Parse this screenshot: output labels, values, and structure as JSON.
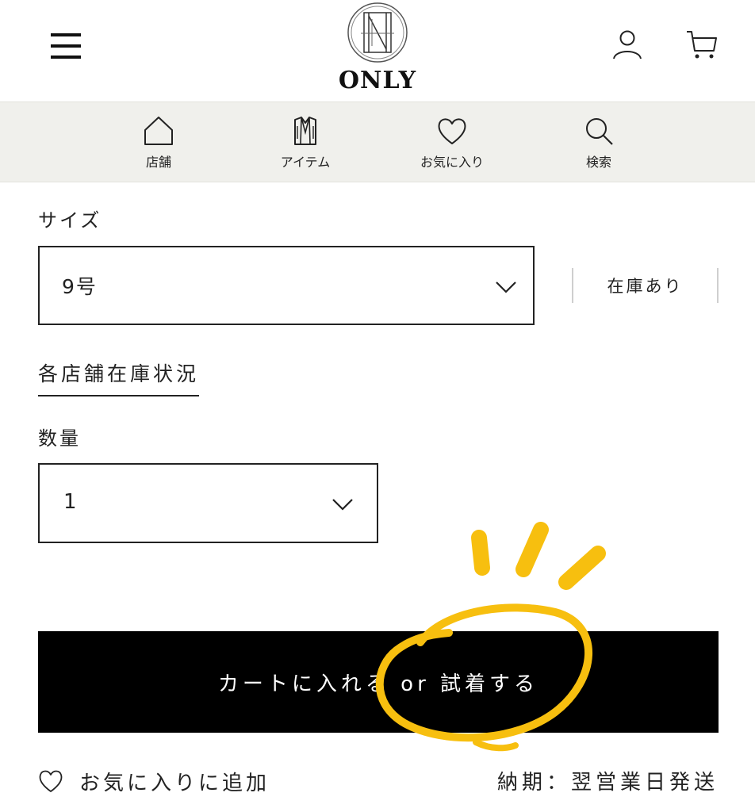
{
  "header": {
    "logo_text": "ONLY",
    "menu_icon": "hamburger-icon",
    "account_icon": "user-icon",
    "cart_icon": "cart-icon"
  },
  "nav": [
    {
      "label": "店舗",
      "icon": "home-icon"
    },
    {
      "label": "アイテム",
      "icon": "jacket-icon"
    },
    {
      "label": "お気に入り",
      "icon": "heart-icon"
    },
    {
      "label": "検索",
      "icon": "search-icon"
    }
  ],
  "size": {
    "label": "サイズ",
    "selected": "9号",
    "stock_status": "在庫あり"
  },
  "store_stock_link": "各店舗在庫状況",
  "quantity": {
    "label": "数量",
    "selected": "1"
  },
  "cart_button": {
    "label": "カートに入れる or 試着する"
  },
  "favorite_add": {
    "label": "お気に入りに追加",
    "icon": "heart-icon"
  },
  "delivery": "納期：翌営業日発送",
  "colors": {
    "accent_annotation": "#f7bf0f",
    "button_bg": "#000000",
    "nav_bg": "#f0f0ec"
  }
}
